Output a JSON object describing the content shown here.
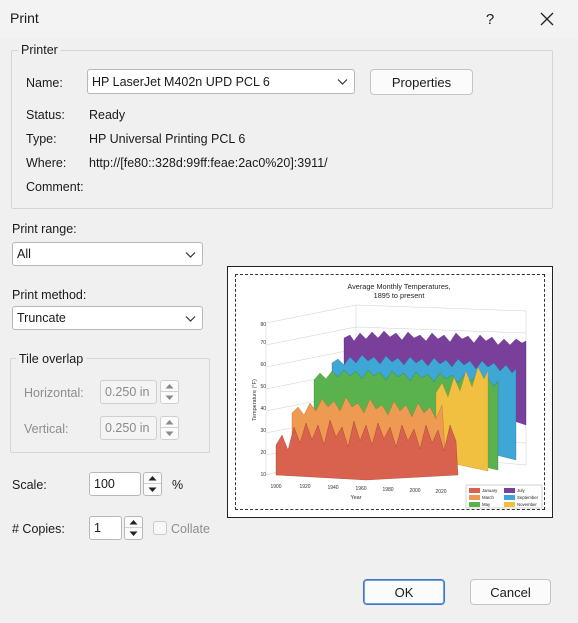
{
  "window": {
    "title": "Print",
    "help_label": "?"
  },
  "printer": {
    "group_label": "Printer",
    "name_label": "Name:",
    "name_value": "HP LaserJet M402n UPD PCL 6",
    "properties_label": "Properties",
    "status_label": "Status:",
    "status_value": "Ready",
    "type_label": "Type:",
    "type_value": "HP Universal Printing PCL 6",
    "where_label": "Where:",
    "where_value": "http://[fe80::328d:99ff:feae:2ac0%20]:3911/",
    "comment_label": "Comment:",
    "comment_value": ""
  },
  "print_range": {
    "label": "Print range:",
    "value": "All"
  },
  "print_method": {
    "label": "Print method:",
    "value": "Truncate"
  },
  "tile_overlap": {
    "group_label": "Tile overlap",
    "horizontal_label": "Horizontal:",
    "horizontal_value": "0.250 in",
    "vertical_label": "Vertical:",
    "vertical_value": "0.250 in"
  },
  "scale": {
    "label": "Scale:",
    "value": "100",
    "unit": "%"
  },
  "copies": {
    "label": "# Copies:",
    "value": "1",
    "collate_label": "Collate",
    "collate_checked": false
  },
  "buttons": {
    "ok": "OK",
    "cancel": "Cancel"
  },
  "colors": {
    "accent": "#3a78c7",
    "background": "#f0f0f0"
  },
  "preview_chart": {
    "title_line1": "Average Monthly Temperatures,",
    "title_line2": "1895 to present",
    "xlabel": "Year",
    "ylabel": "Temperature (°F)",
    "x_ticks": [
      "1900",
      "1920",
      "1940",
      "1960",
      "1980",
      "2000",
      "2020"
    ],
    "y_ticks": [
      "10",
      "20",
      "30",
      "40",
      "50",
      "60",
      "70",
      "80"
    ],
    "legend": [
      "January",
      "July",
      "March",
      "September",
      "May",
      "November"
    ]
  },
  "chart_data": {
    "type": "area",
    "title": "Average Monthly Temperatures, 1895 to present",
    "xlabel": "Year",
    "ylabel": "Temperature (°F)",
    "x_range": [
      1895,
      2020
    ],
    "ylim": [
      10,
      80
    ],
    "legend_position": "bottom-right",
    "series": [
      {
        "name": "January",
        "color": "#d9624f",
        "level": 30
      },
      {
        "name": "March",
        "color": "#ef9a52",
        "level": 42
      },
      {
        "name": "May",
        "color": "#5ab24f",
        "level": 58
      },
      {
        "name": "July",
        "color": "#7a3f9a",
        "level": 73
      },
      {
        "name": "September",
        "color": "#3fa7d6",
        "level": 65
      },
      {
        "name": "November",
        "color": "#f2c041",
        "level": 45
      }
    ]
  }
}
